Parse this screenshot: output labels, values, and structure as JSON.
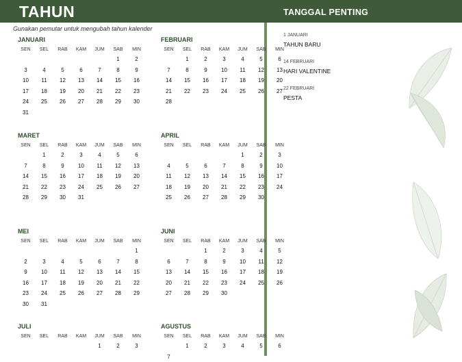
{
  "header": {
    "title": "TAHUN",
    "right_title": "TANGGAL PENTING"
  },
  "instruction": "Gunakan pemutar untuk mengubah tahun kalender",
  "weekdays": [
    "SEN",
    "SEL",
    "RAB",
    "KAM",
    "JUM",
    "SAB",
    "MIN"
  ],
  "months": [
    {
      "name": "JANUARI",
      "days": [
        "",
        "",
        "",
        "",
        "",
        "1",
        "2",
        "3",
        "4",
        "5",
        "6",
        "7",
        "8",
        "9",
        "10",
        "11",
        "12",
        "13",
        "14",
        "15",
        "16",
        "17",
        "18",
        "19",
        "20",
        "21",
        "22",
        "23",
        "24",
        "25",
        "26",
        "27",
        "28",
        "29",
        "30",
        "31"
      ]
    },
    {
      "name": "FEBRUARI",
      "days": [
        "",
        "1",
        "2",
        "3",
        "4",
        "5",
        "6",
        "7",
        "8",
        "9",
        "10",
        "11",
        "12",
        "13",
        "14",
        "15",
        "16",
        "17",
        "18",
        "19",
        "20",
        "21",
        "22",
        "23",
        "24",
        "25",
        "26",
        "27",
        "28"
      ]
    },
    {
      "name": "MARET",
      "days": [
        "",
        "1",
        "2",
        "3",
        "4",
        "5",
        "6",
        "7",
        "8",
        "9",
        "10",
        "11",
        "12",
        "13",
        "14",
        "15",
        "16",
        "17",
        "18",
        "19",
        "20",
        "21",
        "22",
        "23",
        "24",
        "25",
        "26",
        "27",
        "28",
        "29",
        "30",
        "31"
      ]
    },
    {
      "name": "APRIL",
      "days": [
        "",
        "",
        "",
        "",
        "1",
        "2",
        "3",
        "4",
        "5",
        "6",
        "7",
        "8",
        "9",
        "10",
        "11",
        "12",
        "13",
        "14",
        "15",
        "16",
        "17",
        "18",
        "19",
        "20",
        "21",
        "22",
        "23",
        "24",
        "25",
        "26",
        "27",
        "28",
        "29",
        "30"
      ]
    },
    {
      "name": "MEI",
      "days": [
        "",
        "",
        "",
        "",
        "",
        "",
        "1",
        "2",
        "3",
        "4",
        "5",
        "6",
        "7",
        "8",
        "9",
        "10",
        "11",
        "12",
        "13",
        "14",
        "15",
        "16",
        "17",
        "18",
        "19",
        "20",
        "21",
        "22",
        "23",
        "24",
        "25",
        "26",
        "27",
        "28",
        "29",
        "30",
        "31"
      ]
    },
    {
      "name": "JUNI",
      "days": [
        "",
        "",
        "1",
        "2",
        "3",
        "4",
        "5",
        "6",
        "7",
        "8",
        "9",
        "10",
        "11",
        "12",
        "13",
        "14",
        "15",
        "16",
        "17",
        "18",
        "19",
        "20",
        "21",
        "22",
        "23",
        "24",
        "25",
        "26",
        "27",
        "28",
        "29",
        "30"
      ]
    },
    {
      "name": "JULI",
      "days": [
        "",
        "",
        "",
        "",
        "1",
        "2",
        "3"
      ]
    },
    {
      "name": "AGUSTUS",
      "days": [
        "",
        "1",
        "2",
        "3",
        "4",
        "5",
        "6",
        "7"
      ]
    }
  ],
  "events": [
    {
      "date": "1 JANUARI",
      "name": "TAHUN BARU"
    },
    {
      "date": "14 FEBRUARI",
      "name": "HARI VALENTINE"
    },
    {
      "date": "22 FEBRUARI",
      "name": "PESTA"
    }
  ],
  "colors": {
    "banner": "#3f5a38",
    "divider": "#6f8e63",
    "month_title": "#2e4f2a"
  }
}
